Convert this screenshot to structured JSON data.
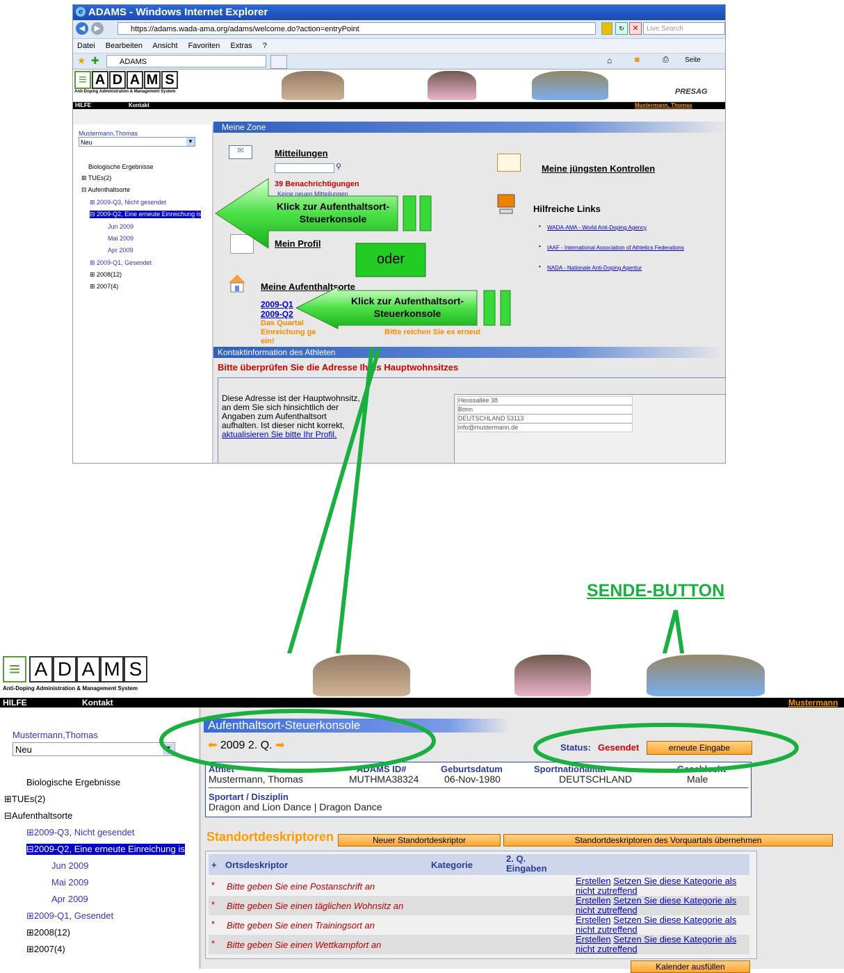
{
  "browser": {
    "title": "ADAMS - Windows Internet Explorer",
    "url": "https://adams.wada-ama.org/adams/welcome.do?action=entryPoint",
    "search_placeholder": "Live Search",
    "menu": [
      "Datei",
      "Bearbeiten",
      "Ansicht",
      "Favoriten",
      "Extras",
      "?"
    ],
    "tab_label": "ADAMS",
    "toolbar_page": "Seite"
  },
  "logo": {
    "letters": [
      "A",
      "D",
      "A",
      "M",
      "S"
    ],
    "subtitle": "Anti-Doping Administration & Management System"
  },
  "topnav": {
    "help": "HILFE",
    "contact": "Kontakt",
    "user": "Mustermann, Thomas",
    "user_short": "Mustermann",
    "presage": "PRESAG"
  },
  "sidebar": {
    "user": "Mustermann,Thomas",
    "select_value": "Neu",
    "items": {
      "bio": "Biologische Ergebnisse",
      "tues": "TUEs(2)",
      "whereabouts": "Aufenthaltsorte",
      "q3": "2009-Q3, Nicht gesendet",
      "q2": "2009-Q2, Eine erneute Einreichung is",
      "jun": "Jun 2009",
      "mai": "Mai 2009",
      "apr": "Apr 2009",
      "q1": "2009-Q1, Gesendet",
      "y2008": "2008(12)",
      "y2007": "2007(4)"
    }
  },
  "zone": {
    "header": "Meine Zone",
    "messages": "Mitteilungen",
    "notifications": "39 Benachrichtigungen",
    "no_new": "Keine neuen Mitteilungen",
    "profile": "Mein Profil",
    "whereabouts": "Meine Aufenthaltsorte",
    "q1_link": "2009-Q1",
    "q2_link": "2009-Q2",
    "quarter_note": "Das Quartal ... Einreichung ge... Bitte reichen Sie es erneut ein!",
    "quarter_note_a": "Das Quartal",
    "quarter_note_b": "Einreichung ge",
    "quarter_note_c": "Bitte reichen Sie es erneut",
    "quarter_note_d": "ein!",
    "controls": "Meine jüngsten Kontrollen",
    "links_title": "Hilfreiche Links",
    "links": [
      "WADA-AMA - World Anti-Doping Agency",
      "IAAF - International Association of Athletics Federations",
      "NADA - Nationale Anti-Doping Agentur"
    ]
  },
  "contact": {
    "header": "Kontaktinformation des Athleten",
    "warning": "Bitte überprüfen Sie die Adresse Ihres Hauptwohnsitzes",
    "text": "Diese Adresse ist der Hauptwohnsitz, an dem Sie sich hinsichtlich der Angaben zum Aufenthaltsort aufhalten. Ist dieser nicht korrekt,",
    "update_link": "aktualisieren Sie bitte Ihr Profil.",
    "address": [
      "Heussallee 38",
      "Bonn",
      "DEUTSCHLAND 53113",
      "info@mustermann.de"
    ]
  },
  "annotations": {
    "arrow1": "Klick zur Aufenthaltsort-Steuerkonsole",
    "arrow2": "Klick zur Aufenthaltsort-Steuerkonsole",
    "oder": "oder",
    "send_button": "SENDE-BUTTON"
  },
  "console": {
    "title": "Aufenthaltsort-Steuerkonsole",
    "quarter": "2009 2. Q.",
    "status_label": "Status:",
    "status_value": "Gesendet",
    "resubmit_button": "erneute Eingabe",
    "athlete_label": "Athlet",
    "athlete_value": "Mustermann, Thomas",
    "id_label": "ADAMS ID#",
    "id_value": "MUTHMA38324",
    "dob_label": "Geburtsdatum",
    "dob_value": "06-Nov-1980",
    "nation_label": "Sportnationalität",
    "nation_value": "DEUTSCHLAND",
    "gender_label": "Geschlecht",
    "gender_value": "Male",
    "sport_label": "Sportart / Disziplin",
    "sport_value": "Dragon and Lion Dance | Dragon Dance",
    "locations_title": "Standortdeskriptoren",
    "new_location_button": "Neuer Standortdeskriptor",
    "copy_button": "Standortdeskriptoren des Vorquartals übernehmen",
    "col_plus": "+",
    "col_descriptor": "Ortsdeskriptor",
    "col_category": "Kategorie",
    "col_entries": "2. Q. Eingaben",
    "rows": [
      "Bitte geben Sie eine Postanschrift an",
      "Bitte geben Sie einen täglichen Wohnsitz an",
      "Bitte geben Sie einen Trainingsort an",
      "Bitte geben Sie einen Wettkampfort an"
    ],
    "action_create": "Erstellen",
    "action_na": "Setzen Sie diese Kategorie als nicht zutreffend",
    "calendar_button": "Kalender ausfüllen"
  }
}
